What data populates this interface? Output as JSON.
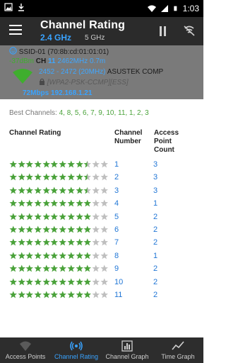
{
  "status_bar": {
    "time": "1:03"
  },
  "toolbar": {
    "title": "Channel Rating",
    "band_active": "2.4 GHz",
    "band_inactive": "5 GHz"
  },
  "access_point": {
    "ssid_line": "SSID-01 (70:8b:cd:01:01:01)",
    "signal": "-37dBm",
    "channel_label": "CH",
    "channel": "11",
    "frequency": "2462MHz",
    "distance": "0.7m",
    "range": "2452 - 2472 (20MHz)",
    "vendor": "ASUSTEK COMP",
    "security": "[WPA2-PSK-CCMP][ESS]",
    "speed_ip": "72Mbps 192.168.1.21"
  },
  "best_channels": {
    "label": "Best Channels:",
    "values": "4, 8, 5, 6, 7, 9, 10, 11, 1, 2, 3"
  },
  "table": {
    "headers": {
      "rating": "Channel Rating",
      "channel": "Channel\nNumber",
      "count": "Access\nPoint\nCount"
    },
    "rows": [
      {
        "channel": "1",
        "count": "3",
        "stars": 9.5
      },
      {
        "channel": "2",
        "count": "3",
        "stars": 9.5
      },
      {
        "channel": "3",
        "count": "3",
        "stars": 9.5
      },
      {
        "channel": "4",
        "count": "1",
        "stars": 10
      },
      {
        "channel": "5",
        "count": "2",
        "stars": 10
      },
      {
        "channel": "6",
        "count": "2",
        "stars": 10
      },
      {
        "channel": "7",
        "count": "2",
        "stars": 10
      },
      {
        "channel": "8",
        "count": "1",
        "stars": 10
      },
      {
        "channel": "9",
        "count": "2",
        "stars": 10
      },
      {
        "channel": "10",
        "count": "2",
        "stars": 10
      },
      {
        "channel": "11",
        "count": "2",
        "stars": 10
      }
    ],
    "max_stars": 12
  },
  "bottom_nav": [
    {
      "label": "Access Points",
      "icon": "wifi-icon",
      "active": false
    },
    {
      "label": "Channel Rating",
      "icon": "signal-icon",
      "active": true
    },
    {
      "label": "Channel Graph",
      "icon": "bar-chart-icon",
      "active": false
    },
    {
      "label": "Time Graph",
      "icon": "line-chart-icon",
      "active": false
    }
  ],
  "colors": {
    "accent": "#39a3ff",
    "star_full": "#4aa23a",
    "star_empty": "#bfbfbf",
    "link": "#2277d6",
    "panel": "#7a7a7a"
  }
}
